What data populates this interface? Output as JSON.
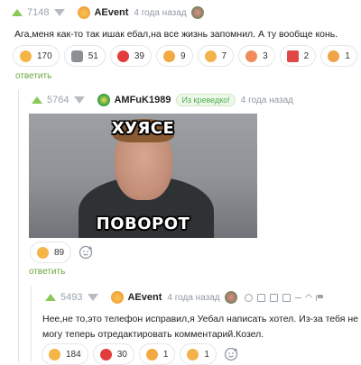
{
  "colors": {
    "accent_green": "#6aa843",
    "vote_up": "#8ac858",
    "vote_down": "#b7bcc3",
    "muted": "#8f98a3"
  },
  "comment1": {
    "score": "7148",
    "author": "AEvent",
    "time": "4 года назад",
    "text": "Ага,меня как-то так ишак ебал,на все жизнь запомнил. А ту вообще конь.",
    "reactions": [
      {
        "icon": "laughing-face-icon",
        "count": "170"
      },
      {
        "icon": "moai-icon",
        "count": "51"
      },
      {
        "icon": "strawberry-icon",
        "count": "39"
      },
      {
        "icon": "grinning-face-icon",
        "count": "9"
      },
      {
        "icon": "heart-face-icon",
        "count": "7"
      },
      {
        "icon": "kiss-face-icon",
        "count": "3"
      },
      {
        "icon": "hundred-icon",
        "count": "2"
      },
      {
        "icon": "thumbs-icon",
        "count": "1"
      }
    ],
    "reply_label": "ответить"
  },
  "comment2": {
    "score": "5764",
    "author": "AMFuK1989",
    "badge": "Из креведко!",
    "time": "4 года назад",
    "meme_top": "ХУЯСЕ",
    "meme_bottom": "ПОВОРОТ",
    "reactions": [
      {
        "icon": "laughing-face-icon",
        "count": "89"
      }
    ],
    "reply_label": "ответить"
  },
  "comment3": {
    "score": "5493",
    "author": "AEvent",
    "time": "4 года назад",
    "text": "Нее,не то,это телефон исправил,я Уебал написать хотел. Из-за тебя не могу теперь отредактировать комментарий.Козел.",
    "reactions": [
      {
        "icon": "laughing-face-icon",
        "count": "184"
      },
      {
        "icon": "strawberry-icon",
        "count": "30"
      },
      {
        "icon": "grinning-face-icon",
        "count": "1"
      },
      {
        "icon": "heart-face-icon",
        "count": "1"
      }
    ]
  }
}
